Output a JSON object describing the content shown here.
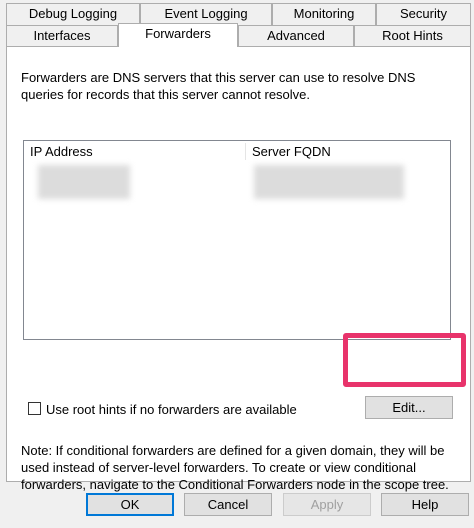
{
  "tabs_row1": [
    "Debug Logging",
    "Event Logging",
    "Monitoring",
    "Security"
  ],
  "tabs_row2": [
    "Interfaces",
    "Forwarders",
    "Advanced",
    "Root Hints"
  ],
  "active_tab": "Forwarders",
  "description": "Forwarders are DNS servers that this server can use to resolve DNS queries for records that this server cannot resolve.",
  "description_lines": [
    "Forwarders are DNS servers that this server can use to resolve DNS",
    "queries for records that this server cannot resolve."
  ],
  "list": {
    "columns": [
      "IP Address",
      "Server FQDN"
    ],
    "rows_redacted": true
  },
  "checkbox": {
    "label": "Use root hints if no forwarders are available",
    "checked": false
  },
  "edit_button": "Edit...",
  "note_lines": [
    "Note: If conditional forwarders are defined for a given domain, they will be",
    "used instead of server-level forwarders.  To create or view conditional",
    "forwarders, navigate to the Conditional Forwarders node in the scope tree."
  ],
  "buttons": {
    "ok": "OK",
    "cancel": "Cancel",
    "apply": "Apply",
    "help": "Help"
  },
  "colors": {
    "highlight": "#e8336b",
    "default_button_border": "#0078d7"
  }
}
